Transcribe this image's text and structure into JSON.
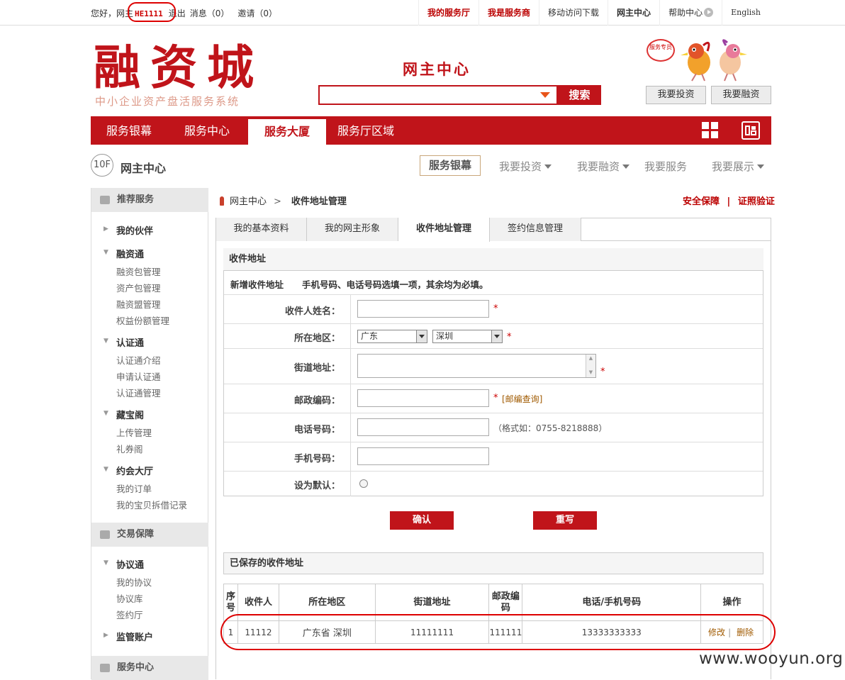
{
  "topbar": {
    "greeting": "您好，网主",
    "username": "HE1111",
    "logout": "退出",
    "messages": "消息（0）",
    "invites": "邀请（0）",
    "links": [
      "我的服务厅",
      "我是服务商",
      "移动访问下载",
      "网主中心",
      "帮助中心",
      "English"
    ]
  },
  "header": {
    "logo": "融资城",
    "logo_sub": "中小企业资产盘活服务系统",
    "center_title": "网主中心",
    "search_placeholder": "",
    "search_button": "搜索",
    "badge": "服务专员",
    "btn_invest": "我要投资",
    "btn_finance": "我要融资"
  },
  "nav": {
    "items": [
      "服务银幕",
      "服务中心",
      "服务大厦",
      "服务厅区域"
    ],
    "active": "服务大厦"
  },
  "floor": {
    "badge": "10F",
    "title": "网主中心",
    "nav": [
      "服务银幕",
      "我要投资",
      "我要融资",
      "我要服务",
      "我要展示"
    ]
  },
  "sidebar": {
    "recommend": "推荐服务",
    "partners": "我的伙伴",
    "groups": [
      {
        "title": "融资通",
        "items": [
          "融资包管理",
          "资产包管理",
          "融资盟管理",
          "权益份额管理"
        ]
      },
      {
        "title": "认证通",
        "items": [
          "认证通介绍",
          "申请认证通",
          "认证通管理"
        ]
      },
      {
        "title": "藏宝阁",
        "items": [
          "上传管理",
          "礼券阁"
        ]
      },
      {
        "title": "约会大厅",
        "items": [
          "我的订单",
          "我的宝贝拆借记录"
        ]
      }
    ],
    "trade": "交易保障",
    "protocol": {
      "title": "协议通",
      "items": [
        "我的协议",
        "协议库",
        "签约厅"
      ]
    },
    "supervise": "监管账户",
    "service_center": "服务中心"
  },
  "breadcrumb": {
    "home": "网主中心",
    "current": "收件地址管理"
  },
  "security": {
    "a": "安全保障",
    "sep": "|",
    "b": "证照验证"
  },
  "tabs": [
    "我的基本资料",
    "我的网主形象",
    "收件地址管理",
    "签约信息管理"
  ],
  "form": {
    "title": "收件地址",
    "subtitle": "新增收件地址",
    "note": "手机号码、电话号码选填一项，其余均为必填。",
    "labels": {
      "name": "收件人姓名：",
      "region": "所在地区：",
      "street": "街道地址：",
      "zip": "邮政编码：",
      "phone": "电话号码：",
      "mobile": "手机号码：",
      "default": "设为默认："
    },
    "province": "广东",
    "city": "深圳",
    "zip_link": "[邮编查询]",
    "phone_hint": "（格式如：0755-8218888）",
    "required": "*",
    "confirm": "确认",
    "reset": "重写"
  },
  "saved": {
    "title": "已保存的收件地址",
    "columns": [
      "序号",
      "收件人",
      "所在地区",
      "街道地址",
      "邮政编码",
      "电话/手机号码",
      "操作"
    ],
    "rows": [
      {
        "no": "1",
        "name": "11112",
        "region": "广东省 深圳",
        "street": "11111111",
        "zip": "111111",
        "phone": "13333333333",
        "edit": "修改",
        "sep": "|",
        "del": "删除"
      }
    ]
  },
  "watermark": "www.wooyun.org"
}
